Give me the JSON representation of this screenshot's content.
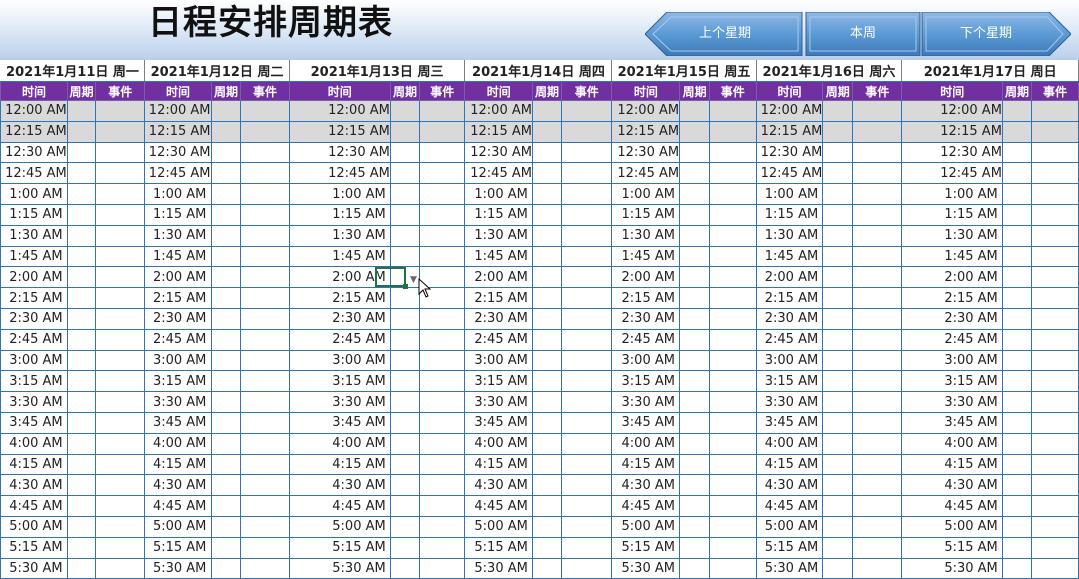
{
  "title": "日程安排周期表",
  "nav": {
    "prev": "上个星期",
    "current": "本周",
    "next": "下个星期"
  },
  "days": [
    "2021年1月11日 周一",
    "2021年1月12日 周二",
    "2021年1月13日 周三",
    "2021年1月14日 周四",
    "2021年1月15日 周五",
    "2021年1月16日 周六",
    "2021年1月17日 周日"
  ],
  "col_headers": {
    "time": "时间",
    "period": "周期",
    "event": "事件"
  },
  "times": [
    "12:00 AM",
    "12:15 AM",
    "12:30 AM",
    "12:45 AM",
    "1:00 AM",
    "1:15 AM",
    "1:30 AM",
    "1:45 AM",
    "2:00 AM",
    "2:15 AM",
    "2:30 AM",
    "2:45 AM",
    "3:00 AM",
    "3:15 AM",
    "3:30 AM",
    "3:45 AM",
    "4:00 AM",
    "4:15 AM",
    "4:30 AM",
    "4:45 AM",
    "5:00 AM",
    "5:15 AM",
    "5:30 AM"
  ],
  "highlighted_rows": [
    0,
    1
  ],
  "colors": {
    "header_purple": "#7030a0",
    "grid_blue": "#2e75b6",
    "nav_blue": "#5b9bd5",
    "highlight_gray": "#d9d9d9"
  }
}
